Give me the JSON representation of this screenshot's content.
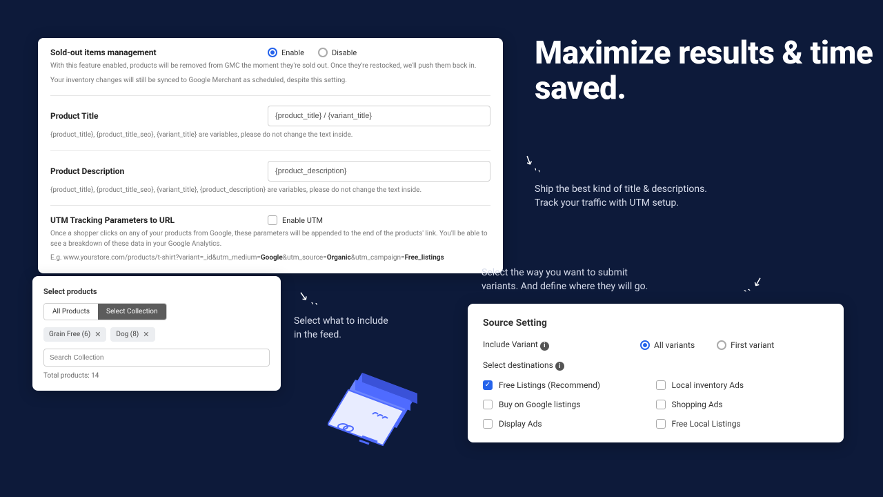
{
  "headline": "Maximize results & time saved.",
  "captions": {
    "c1": "Ship the best kind of title & descriptions.\nTrack your traffic with UTM setup.",
    "c2": "Select what to include\nin the feed.",
    "c3": "Select the way you want to submit\nvariants. And define where they will go."
  },
  "settings": {
    "soldout": {
      "title": "Sold-out items management",
      "enable": "Enable",
      "disable": "Disable",
      "selected": "enable",
      "desc1": "With this feature enabled, products will be removed from GMC the moment they're sold out. Once they're restocked, we'll push them back in.",
      "desc2": "Your inventory changes will still be synced to Google Merchant as scheduled, despite this setting."
    },
    "ptitle": {
      "title": "Product Title",
      "value": "{product_title} / {variant_title}",
      "desc": "{product_title}, {product_title_seo}, {variant_title} are variables, please do not change the text inside."
    },
    "pdesc": {
      "title": "Product Description",
      "value": "{product_description}",
      "desc": "{product_title}, {product_title_seo}, {variant_title}, {product_description} are variables, please do not change the text inside."
    },
    "utm": {
      "title": "UTM Tracking Parameters to URL",
      "cblabel": "Enable UTM",
      "desc1": "Once a shopper clicks on any of your products from Google, these parameters will be appended to the end of the products' link. You'll be able to see a breakdown of these data in your Google Analytics.",
      "eg_prefix": "E.g. www.yourstore.com/products/t-shirt?variant=_id&utm_medium=",
      "eg_b1": "Google",
      "eg_mid1": "&utm_source=",
      "eg_b2": "Organic",
      "eg_mid2": "&utm_campaign=",
      "eg_b3": "Free_listings"
    }
  },
  "select": {
    "title": "Select products",
    "tab_all": "All Products",
    "tab_coll": "Select Collection",
    "chips": {
      "a": "Grain Free (6)",
      "b": "Dog (8)"
    },
    "search_ph": "Search Collection",
    "total_label": "Total products: ",
    "total_value": "14"
  },
  "source": {
    "title": "Source Setting",
    "include_label": "Include Variant",
    "opt_all": "All variants",
    "opt_first": "First variant",
    "selected": "all",
    "dest_label": "Select destinations",
    "dests": {
      "free": "Free Listings (Recommend)",
      "local": "Local inventory Ads",
      "buy": "Buy on Google listings",
      "shopping": "Shopping Ads",
      "display": "Display Ads",
      "freelocal": "Free Local Listings"
    }
  }
}
